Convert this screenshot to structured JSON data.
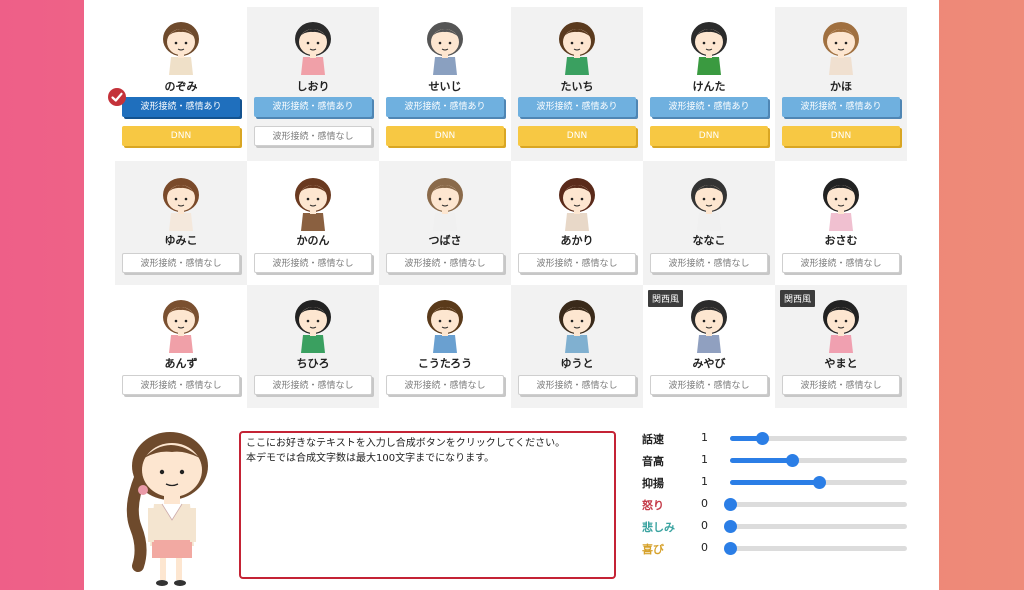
{
  "characters": [
    {
      "name": "のぞみ",
      "wave_label": "波形接続・感情あり",
      "dnn_label": "DNN",
      "selected": true
    },
    {
      "name": "しおり",
      "wave_label": "波形接続・感情あり",
      "plain_label": "波形接続・感情なし"
    },
    {
      "name": "せいじ",
      "wave_label": "波形接続・感情あり",
      "dnn_label": "DNN"
    },
    {
      "name": "たいち",
      "wave_label": "波形接続・感情あり",
      "dnn_label": "DNN"
    },
    {
      "name": "けんた",
      "wave_label": "波形接続・感情あり",
      "dnn_label": "DNN"
    },
    {
      "name": "かほ",
      "wave_label": "波形接続・感情あり",
      "dnn_label": "DNN"
    },
    {
      "name": "ゆみこ",
      "plain_label": "波形接続・感情なし"
    },
    {
      "name": "かのん",
      "plain_label": "波形接続・感情なし"
    },
    {
      "name": "つばさ",
      "plain_label": "波形接続・感情なし"
    },
    {
      "name": "あかり",
      "plain_label": "波形接続・感情なし"
    },
    {
      "name": "ななこ",
      "plain_label": "波形接続・感情なし"
    },
    {
      "name": "おさむ",
      "plain_label": "波形接続・感情なし"
    },
    {
      "name": "あんず",
      "plain_label": "波形接続・感情なし"
    },
    {
      "name": "ちひろ",
      "plain_label": "波形接続・感情なし"
    },
    {
      "name": "こうたろう",
      "plain_label": "波形接続・感情なし"
    },
    {
      "name": "ゆうと",
      "plain_label": "波形接続・感情なし"
    },
    {
      "name": "みやび",
      "plain_label": "波形接続・感情なし",
      "badge": "関西風"
    },
    {
      "name": "やまと",
      "plain_label": "波形接続・感情なし",
      "badge": "関西風"
    }
  ],
  "editor": {
    "line1": "ここにお好きなテキストを入力し合成ボタンをクリックしてください。",
    "line2": "本デモでは合成文字数は最大100文字までになります。"
  },
  "sliders": [
    {
      "label": "話速",
      "value": "1",
      "level": 0.18,
      "color": "#222222"
    },
    {
      "label": "音高",
      "value": "1",
      "level": 0.35,
      "color": "#222222"
    },
    {
      "label": "抑揚",
      "value": "1",
      "level": 0.5,
      "color": "#222222"
    },
    {
      "label": "怒り",
      "value": "0",
      "level": 0.0,
      "color": "#c43a48"
    },
    {
      "label": "悲しみ",
      "value": "0",
      "level": 0.0,
      "color": "#3aa3a0"
    },
    {
      "label": "喜び",
      "value": "0",
      "level": 0.0,
      "color": "#d6a12a"
    }
  ],
  "icons": {
    "selected": "check-circle-icon",
    "avatar": "character-avatar-icon"
  },
  "colors": {
    "wave_button": "#6fb0df",
    "wave_button_selected": "#1f6fbd",
    "dnn_button": "#f7c843",
    "textarea_border": "#c42335",
    "slider": "#2b7ee6"
  }
}
